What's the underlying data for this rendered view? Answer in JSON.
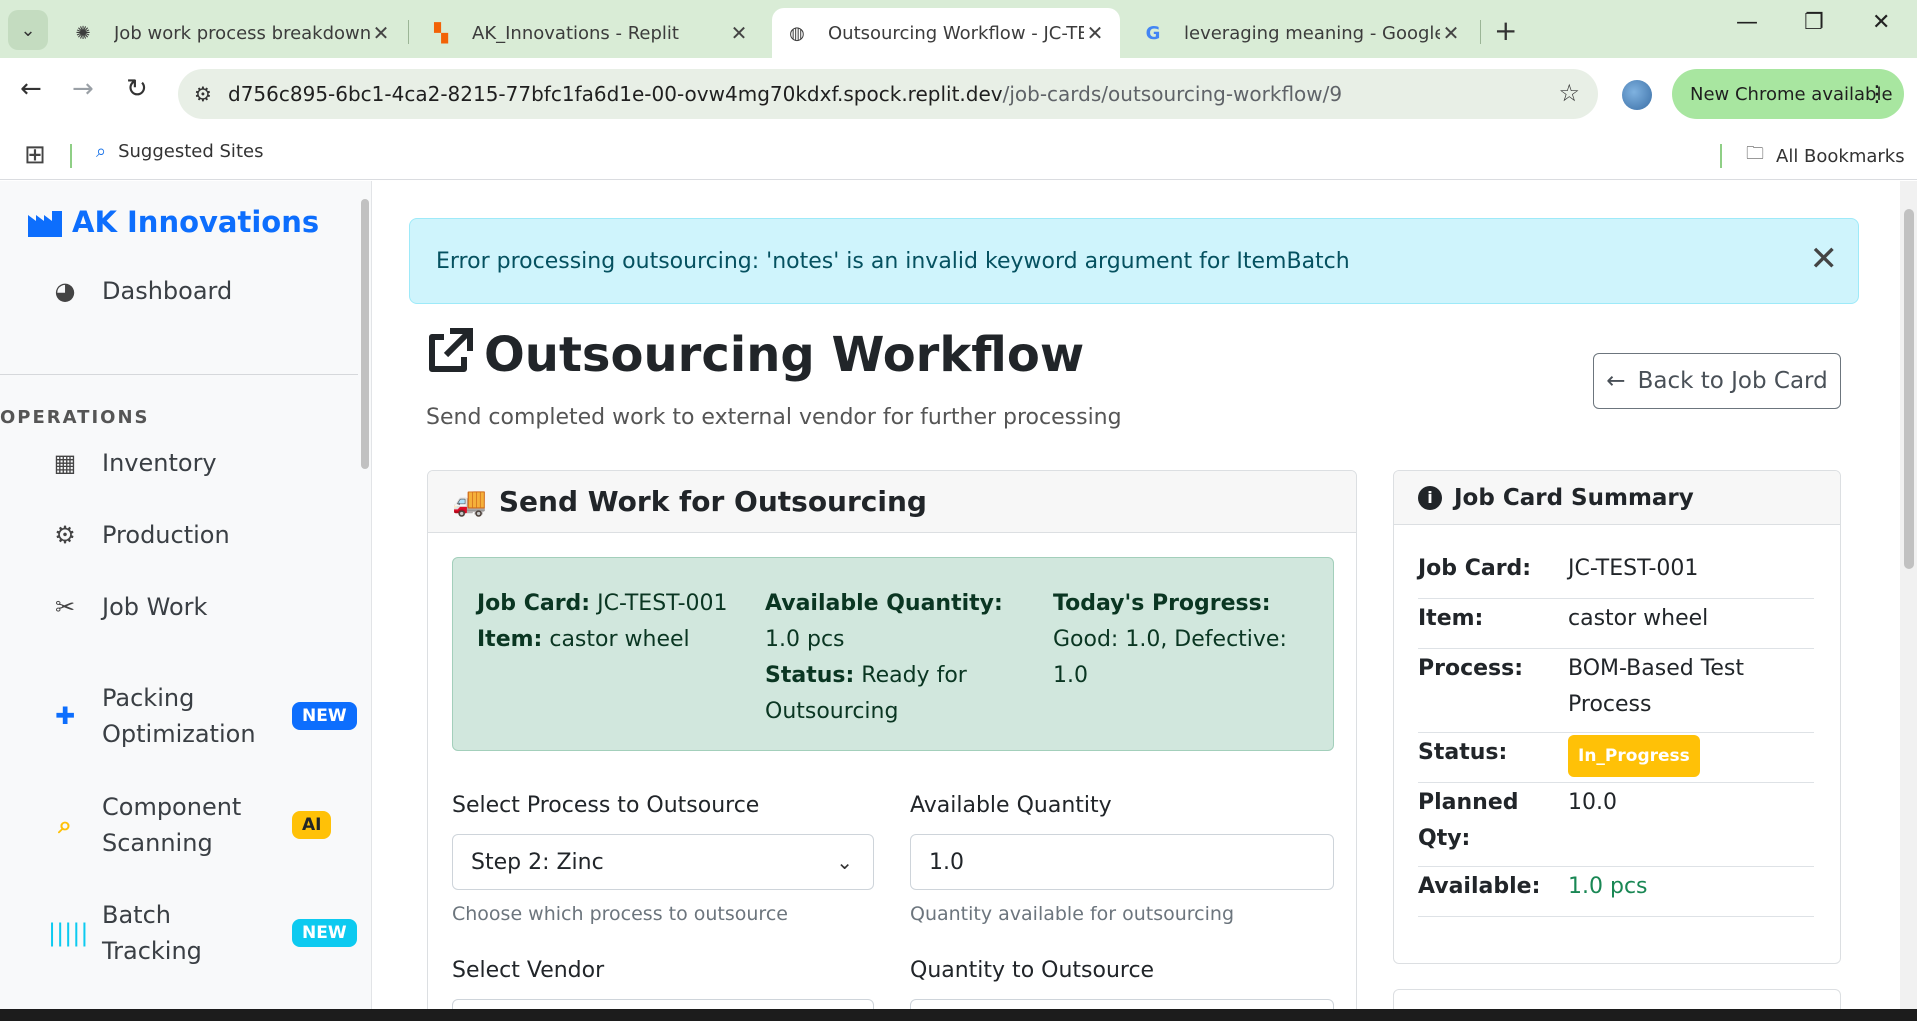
{
  "browser": {
    "tabs": [
      {
        "title": "Job work process breakdown",
        "icon": "openai-icon"
      },
      {
        "title": "AK_Innovations - Replit",
        "icon": "replit-icon"
      },
      {
        "title": "Outsourcing Workflow - JC-TES",
        "icon": "globe-icon"
      },
      {
        "title": "leveraging meaning - Google Se",
        "icon": "google-icon"
      }
    ],
    "url_host": "d756c895-6bc1-4ca2-8215-77bfc1fa6d1e-00-ovw4mg70kdxf.spock.replit.dev",
    "url_path": "/job-cards/outsourcing-workflow/9",
    "update_label": "New Chrome available",
    "bookmarks": {
      "suggested": "Suggested Sites",
      "all": "All Bookmarks"
    }
  },
  "sidebar": {
    "brand": "AK Innovations",
    "dashboard": "Dashboard",
    "section": "OPERATIONS",
    "items": [
      {
        "label": "Inventory",
        "icon": "boxes-icon"
      },
      {
        "label": "Production",
        "icon": "gears-icon"
      },
      {
        "label": "Job Work",
        "icon": "tools-icon"
      },
      {
        "label": "Packing Optimization",
        "icon": "puzzle-icon",
        "badge": "NEW",
        "badge_color": "#0d6efd"
      },
      {
        "label": "Component Scanning",
        "icon": "search-icon",
        "badge": "AI",
        "badge_color": "#ffc107"
      },
      {
        "label": "Batch Tracking",
        "icon": "barcode-icon",
        "badge": "NEW",
        "badge_color": "#0dcaf0"
      }
    ]
  },
  "alert": {
    "message": "Error processing outsourcing: 'notes' is an invalid keyword argument for ItemBatch"
  },
  "page": {
    "title": "Outsourcing Workflow",
    "subtitle": "Send completed work to external vendor for further processing",
    "back_button": "Back to Job Card"
  },
  "send_card": {
    "header": "Send Work for Outsourcing",
    "summary": {
      "job_card_label": "Job Card:",
      "job_card": "JC-TEST-001",
      "item_label": "Item:",
      "item": "castor wheel",
      "available_label": "Available Quantity:",
      "available": "1.0 pcs",
      "status_label": "Status:",
      "status": "Ready for Outsourcing",
      "progress_label": "Today's Progress:",
      "progress": "Good: 1.0, Defective: 1.0"
    },
    "process_label": "Select Process to Outsource",
    "process_value": "Step 2: Zinc",
    "process_help": "Choose which process to outsource",
    "avail_label": "Available Quantity",
    "avail_value": "1.0",
    "avail_help": "Quantity available for outsourcing",
    "vendor_label": "Select Vendor",
    "qty_label": "Quantity to Outsource"
  },
  "job_summary": {
    "header": "Job Card Summary",
    "rows": [
      {
        "k": "Job Card:",
        "v": "JC-TEST-001"
      },
      {
        "k": "Item:",
        "v": "castor wheel"
      },
      {
        "k": "Process:",
        "v": "BOM-Based Test Process"
      },
      {
        "k": "Status:",
        "v": "In_Progress"
      },
      {
        "k": "Planned Qty:",
        "v": "10.0"
      },
      {
        "k": "Available:",
        "v": "1.0 pcs"
      }
    ]
  },
  "colors": {
    "brand": "#0d6efd",
    "alert_bg": "#cff4fc",
    "success_bg": "#d1e7dd",
    "warning": "#ffc107",
    "available_green": "#198754"
  }
}
